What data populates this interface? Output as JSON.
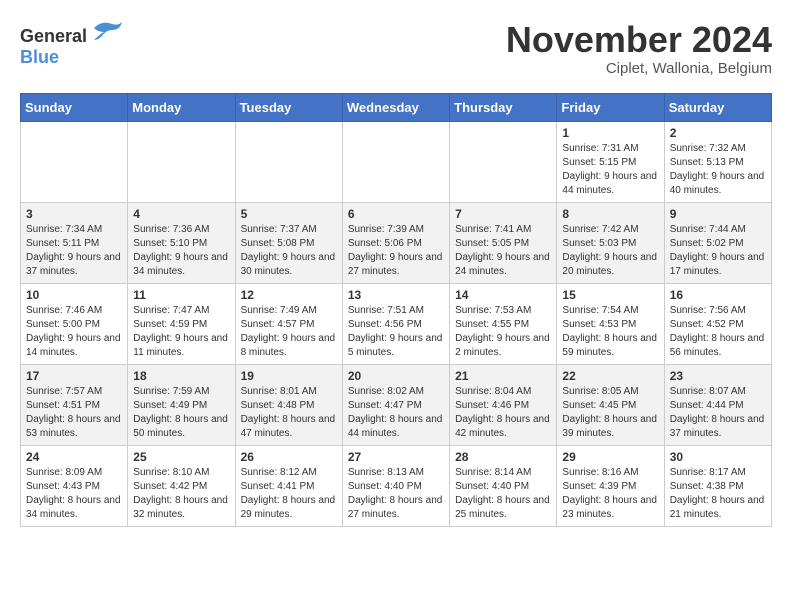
{
  "logo": {
    "general": "General",
    "blue": "Blue"
  },
  "title": "November 2024",
  "location": "Ciplet, Wallonia, Belgium",
  "days_of_week": [
    "Sunday",
    "Monday",
    "Tuesday",
    "Wednesday",
    "Thursday",
    "Friday",
    "Saturday"
  ],
  "weeks": [
    [
      {
        "day": "",
        "info": ""
      },
      {
        "day": "",
        "info": ""
      },
      {
        "day": "",
        "info": ""
      },
      {
        "day": "",
        "info": ""
      },
      {
        "day": "",
        "info": ""
      },
      {
        "day": "1",
        "info": "Sunrise: 7:31 AM\nSunset: 5:15 PM\nDaylight: 9 hours and 44 minutes."
      },
      {
        "day": "2",
        "info": "Sunrise: 7:32 AM\nSunset: 5:13 PM\nDaylight: 9 hours and 40 minutes."
      }
    ],
    [
      {
        "day": "3",
        "info": "Sunrise: 7:34 AM\nSunset: 5:11 PM\nDaylight: 9 hours and 37 minutes."
      },
      {
        "day": "4",
        "info": "Sunrise: 7:36 AM\nSunset: 5:10 PM\nDaylight: 9 hours and 34 minutes."
      },
      {
        "day": "5",
        "info": "Sunrise: 7:37 AM\nSunset: 5:08 PM\nDaylight: 9 hours and 30 minutes."
      },
      {
        "day": "6",
        "info": "Sunrise: 7:39 AM\nSunset: 5:06 PM\nDaylight: 9 hours and 27 minutes."
      },
      {
        "day": "7",
        "info": "Sunrise: 7:41 AM\nSunset: 5:05 PM\nDaylight: 9 hours and 24 minutes."
      },
      {
        "day": "8",
        "info": "Sunrise: 7:42 AM\nSunset: 5:03 PM\nDaylight: 9 hours and 20 minutes."
      },
      {
        "day": "9",
        "info": "Sunrise: 7:44 AM\nSunset: 5:02 PM\nDaylight: 9 hours and 17 minutes."
      }
    ],
    [
      {
        "day": "10",
        "info": "Sunrise: 7:46 AM\nSunset: 5:00 PM\nDaylight: 9 hours and 14 minutes."
      },
      {
        "day": "11",
        "info": "Sunrise: 7:47 AM\nSunset: 4:59 PM\nDaylight: 9 hours and 11 minutes."
      },
      {
        "day": "12",
        "info": "Sunrise: 7:49 AM\nSunset: 4:57 PM\nDaylight: 9 hours and 8 minutes."
      },
      {
        "day": "13",
        "info": "Sunrise: 7:51 AM\nSunset: 4:56 PM\nDaylight: 9 hours and 5 minutes."
      },
      {
        "day": "14",
        "info": "Sunrise: 7:53 AM\nSunset: 4:55 PM\nDaylight: 9 hours and 2 minutes."
      },
      {
        "day": "15",
        "info": "Sunrise: 7:54 AM\nSunset: 4:53 PM\nDaylight: 8 hours and 59 minutes."
      },
      {
        "day": "16",
        "info": "Sunrise: 7:56 AM\nSunset: 4:52 PM\nDaylight: 8 hours and 56 minutes."
      }
    ],
    [
      {
        "day": "17",
        "info": "Sunrise: 7:57 AM\nSunset: 4:51 PM\nDaylight: 8 hours and 53 minutes."
      },
      {
        "day": "18",
        "info": "Sunrise: 7:59 AM\nSunset: 4:49 PM\nDaylight: 8 hours and 50 minutes."
      },
      {
        "day": "19",
        "info": "Sunrise: 8:01 AM\nSunset: 4:48 PM\nDaylight: 8 hours and 47 minutes."
      },
      {
        "day": "20",
        "info": "Sunrise: 8:02 AM\nSunset: 4:47 PM\nDaylight: 8 hours and 44 minutes."
      },
      {
        "day": "21",
        "info": "Sunrise: 8:04 AM\nSunset: 4:46 PM\nDaylight: 8 hours and 42 minutes."
      },
      {
        "day": "22",
        "info": "Sunrise: 8:05 AM\nSunset: 4:45 PM\nDaylight: 8 hours and 39 minutes."
      },
      {
        "day": "23",
        "info": "Sunrise: 8:07 AM\nSunset: 4:44 PM\nDaylight: 8 hours and 37 minutes."
      }
    ],
    [
      {
        "day": "24",
        "info": "Sunrise: 8:09 AM\nSunset: 4:43 PM\nDaylight: 8 hours and 34 minutes."
      },
      {
        "day": "25",
        "info": "Sunrise: 8:10 AM\nSunset: 4:42 PM\nDaylight: 8 hours and 32 minutes."
      },
      {
        "day": "26",
        "info": "Sunrise: 8:12 AM\nSunset: 4:41 PM\nDaylight: 8 hours and 29 minutes."
      },
      {
        "day": "27",
        "info": "Sunrise: 8:13 AM\nSunset: 4:40 PM\nDaylight: 8 hours and 27 minutes."
      },
      {
        "day": "28",
        "info": "Sunrise: 8:14 AM\nSunset: 4:40 PM\nDaylight: 8 hours and 25 minutes."
      },
      {
        "day": "29",
        "info": "Sunrise: 8:16 AM\nSunset: 4:39 PM\nDaylight: 8 hours and 23 minutes."
      },
      {
        "day": "30",
        "info": "Sunrise: 8:17 AM\nSunset: 4:38 PM\nDaylight: 8 hours and 21 minutes."
      }
    ]
  ]
}
